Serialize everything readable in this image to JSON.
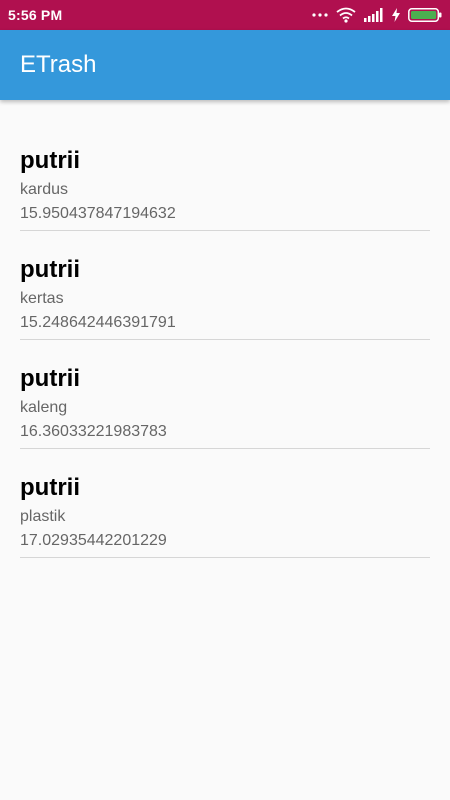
{
  "status_bar": {
    "time": "5:56 PM",
    "colors": {
      "background": "#b0104f",
      "battery_fill": "#4caf50"
    },
    "icons": [
      "more-dots-icon",
      "wifi-icon",
      "signal-icon",
      "charging-icon",
      "battery-icon"
    ]
  },
  "app_bar": {
    "title": "ETrash",
    "color": "#3498db"
  },
  "items": [
    {
      "name": "putrii",
      "category": "kardus",
      "value": "15.950437847194632"
    },
    {
      "name": "putrii",
      "category": "kertas",
      "value": "15.248642446391791"
    },
    {
      "name": "putrii",
      "category": "kaleng",
      "value": "16.36033221983783"
    },
    {
      "name": "putrii",
      "category": "plastik",
      "value": "17.02935442201229"
    }
  ]
}
